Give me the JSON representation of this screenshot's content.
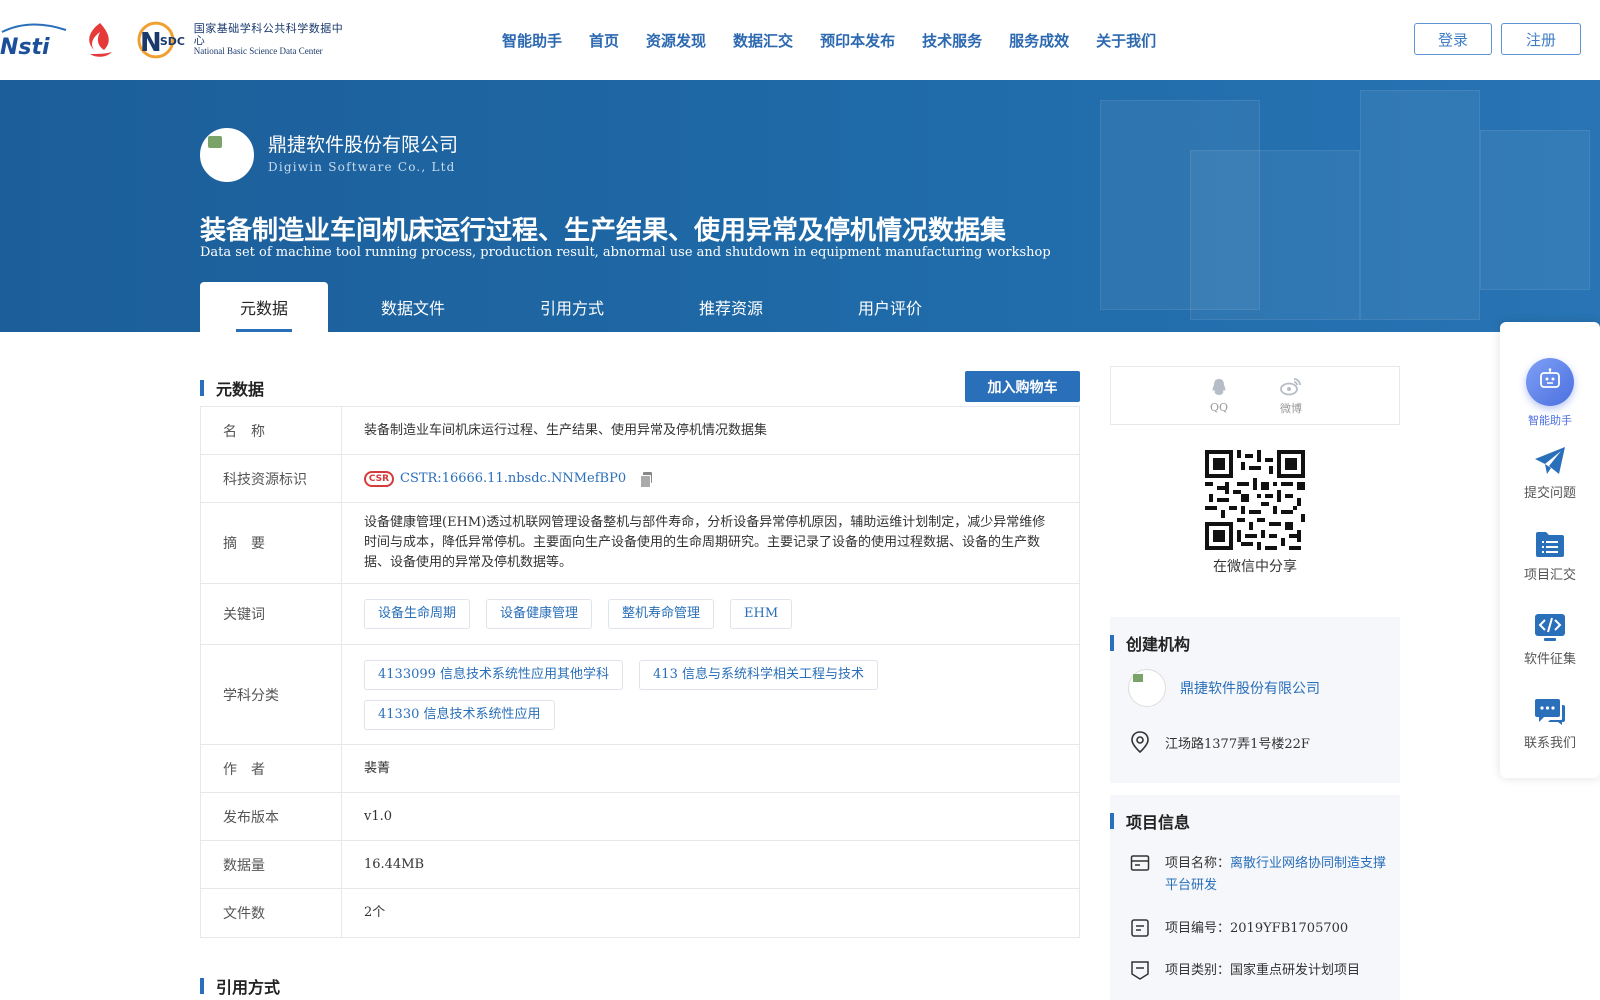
{
  "header": {
    "logo_nsti": "Nsti",
    "logo_nsdc_mark": "SDC",
    "logo_nsdc_cn": "国家基础学科公共科学数据中心",
    "logo_nsdc_en": "National Basic Science Data Center",
    "nav": [
      "智能助手",
      "首页",
      "资源发现",
      "数据汇交",
      "预印本发布",
      "技术服务",
      "服务成效",
      "关于我们"
    ],
    "login": "登录",
    "register": "注册"
  },
  "banner": {
    "org_name": "鼎捷软件股份有限公司",
    "org_name_en": "Digiwin Software Co., Ltd",
    "title": "装备制造业车间机床运行过程、生产结果、使用异常及停机情况数据集",
    "title_en": "Data set of machine tool running process, production result, abnormal use and shutdown in equipment manufacturing workshop",
    "tabs": [
      "元数据",
      "数据文件",
      "引用方式",
      "推荐资源",
      "用户评价"
    ],
    "active_tab": 0
  },
  "metadata_section": {
    "heading": "元数据",
    "cart_button": "加入购物车",
    "rows": {
      "name": {
        "label": "名　称",
        "value": "装备制造业车间机床运行过程、生产结果、使用异常及停机情况数据集"
      },
      "cstr": {
        "label": "科技资源标识",
        "logo": "CSR",
        "value": "CSTR:16666.11.nbsdc.NNMefBP0"
      },
      "abstract": {
        "label": "摘　要",
        "value": "设备健康管理(EHM)透过机联网管理设备整机与部件寿命，分析设备异常停机原因，辅助运维计划制定，减少异常维修时间与成本，降低异常停机。主要面向生产设备使用的生命周期研究。主要记录了设备的使用过程数据、设备的生产数据、设备使用的异常及停机数据等。"
      },
      "keywords": {
        "label": "关键词",
        "tags": [
          "设备生命周期",
          "设备健康管理",
          "整机寿命管理",
          "EHM"
        ]
      },
      "subjects": {
        "label": "学科分类",
        "tags": [
          "4133099 信息技术系统性应用其他学科",
          "413 信息与系统科学相关工程与技术",
          "41330 信息技术系统性应用"
        ]
      },
      "author": {
        "label": "作　者",
        "value": "裴菁"
      },
      "version": {
        "label": "发布版本",
        "value": "v1.0"
      },
      "size": {
        "label": "数据量",
        "value": "16.44MB"
      },
      "files": {
        "label": "文件数",
        "value": "2个"
      }
    }
  },
  "citation_section": {
    "heading": "引用方式"
  },
  "share": {
    "qq": "QQ",
    "weibo": "微博",
    "wechat_caption": "在微信中分享"
  },
  "creator": {
    "heading": "创建机构",
    "org": "鼎捷软件股份有限公司",
    "address": "江场路1377弄1号楼22F"
  },
  "project": {
    "heading": "项目信息",
    "name_label": "项目名称：",
    "name_value": "离散行业网络协同制造支撑平台研发",
    "code_label": "项目编号：",
    "code_value": "2019YFB1705700",
    "type_label": "项目类别：",
    "type_value": "国家重点研发计划项目"
  },
  "float_toolbar": {
    "ai": "智能助手",
    "submit": "提交问题",
    "project": "项目汇交",
    "software": "软件征集",
    "contact": "联系我们"
  },
  "colors": {
    "brand_blue": "#2a6fba",
    "banner_blue": "#1f6aa8",
    "cstr_red": "#d63a3a"
  }
}
